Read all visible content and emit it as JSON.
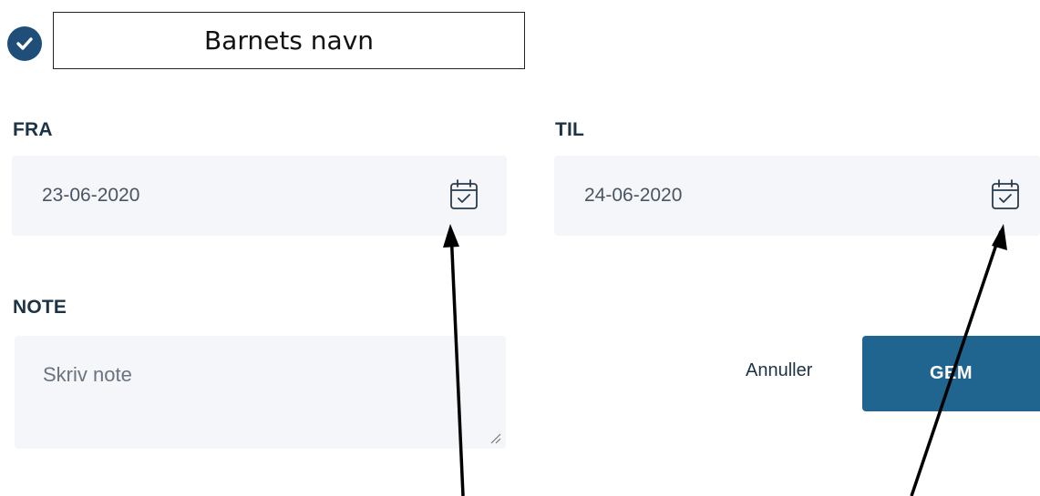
{
  "header": {
    "child_name": "Barnets navn"
  },
  "form": {
    "from_label": "FRA",
    "from_value": "23-06-2020",
    "to_label": "TIL",
    "to_value": "24-06-2020",
    "note_label": "NOTE",
    "note_placeholder": "Skriv note"
  },
  "actions": {
    "cancel_label": "Annuller",
    "save_label": "GEM"
  },
  "icons": {
    "check": "check-circle-icon",
    "calendar": "calendar-check-icon"
  },
  "colors": {
    "accent": "#1f4e79",
    "save_button": "#1f6590",
    "field_bg": "#f4f6f9",
    "label_text": "#1c3346"
  }
}
